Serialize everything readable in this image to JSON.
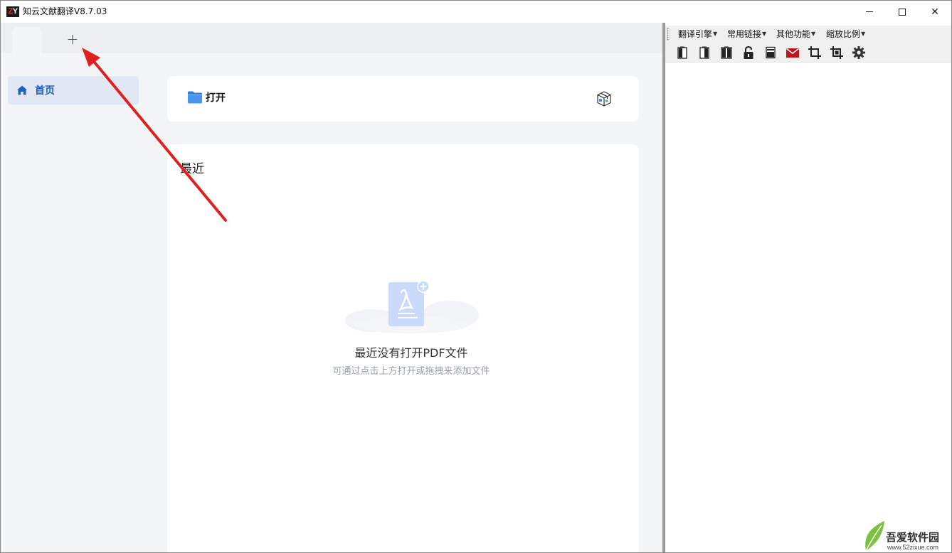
{
  "window": {
    "logo_text": "ZY",
    "title": "知云文献翻译V8.7.03",
    "minimize_label": "",
    "close_label": "✕"
  },
  "tabs": {
    "add_label": "+"
  },
  "sidebar": {
    "items": [
      {
        "label": "首页",
        "icon": "home-icon",
        "active": true
      }
    ]
  },
  "main": {
    "open_label": "打开",
    "recent_title": "最近",
    "empty_title": "最近没有打开PDF文件",
    "empty_subtitle": "可通过点击上方打开或拖拽来添加文件"
  },
  "right_pane": {
    "menus": [
      {
        "label": "翻译引擎"
      },
      {
        "label": "常用链接"
      },
      {
        "label": "其他功能"
      },
      {
        "label": "缩放比例"
      }
    ],
    "toolbar_icons": [
      "layout-left-icon",
      "layout-center-icon",
      "layout-split-icon",
      "unlock-icon",
      "panel-bottom-icon",
      "mail-icon",
      "crop-icon",
      "crop-alt-icon",
      "gear-icon"
    ]
  },
  "watermark": {
    "brand": "吾爱软件园",
    "url": "www.52zixue.com"
  },
  "colors": {
    "accent": "#1f5fc9",
    "nav_active_bg": "#e2e8f3",
    "arrow": "#e02020",
    "mail_red": "#c0141e"
  }
}
